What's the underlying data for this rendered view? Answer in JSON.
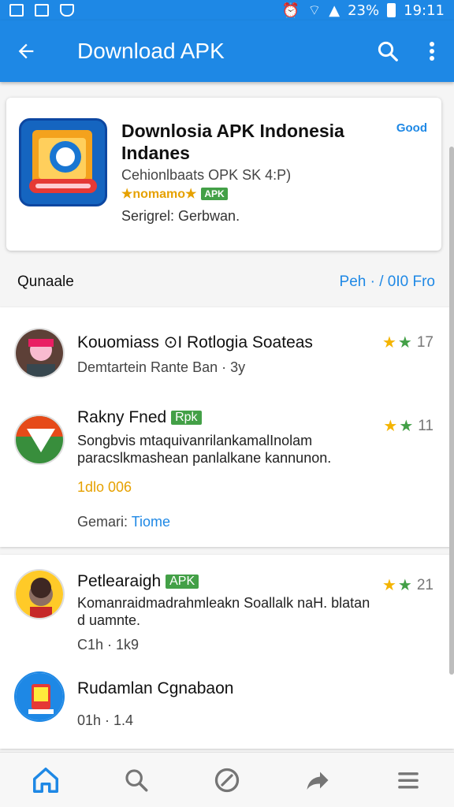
{
  "status_bar": {
    "battery_text": "23%",
    "time": "19:11"
  },
  "app_bar": {
    "title": "Download APK",
    "back_icon": "arrow-left-icon",
    "search_icon": "search-icon",
    "menu_icon": "more-vertical-icon"
  },
  "featured": {
    "title": "Downlosia APK Indonesia Indanes",
    "badge": "Good",
    "developer": "Cehionlbaats OPK SK 4:P)",
    "tags": "★nomamo★",
    "tag_box": "APK",
    "meta": "Serigrel: Gerbwan."
  },
  "section": {
    "title": "Qunaale",
    "link": "Peh · / 0I0 Fro"
  },
  "items": [
    {
      "title": "Kouomiass ⊙I Rotlogia Soateas",
      "subtitle": "Demtartein Rante Ban · 3y",
      "rating": "17"
    },
    {
      "title": "Rakny Fned",
      "tag": "Rpk",
      "description": "Songbvis mtaquivanrilankamalInolam paracslkmashean panlalkane kannunon.",
      "downloads": "1dlo 006",
      "genre_label": "Gemari:",
      "genre_value": "Tiome",
      "rating": "11"
    },
    {
      "title": "Petlearaigh",
      "tag": "APK",
      "description": "Komanraidmadrahmleakn Soallalk naH. blatan d uamnte.",
      "meta": "C1h · 1k9",
      "rating": "21"
    },
    {
      "title": "Rudamlan Cgnabaon",
      "meta": "01h · 1.4"
    }
  ],
  "bottom_nav": [
    "home-icon",
    "search-icon",
    "compass-icon",
    "share-icon",
    "menu-icon"
  ],
  "colors": {
    "primary": "#1e88e5",
    "star": "#f4b400",
    "apk_green": "#43a047"
  }
}
